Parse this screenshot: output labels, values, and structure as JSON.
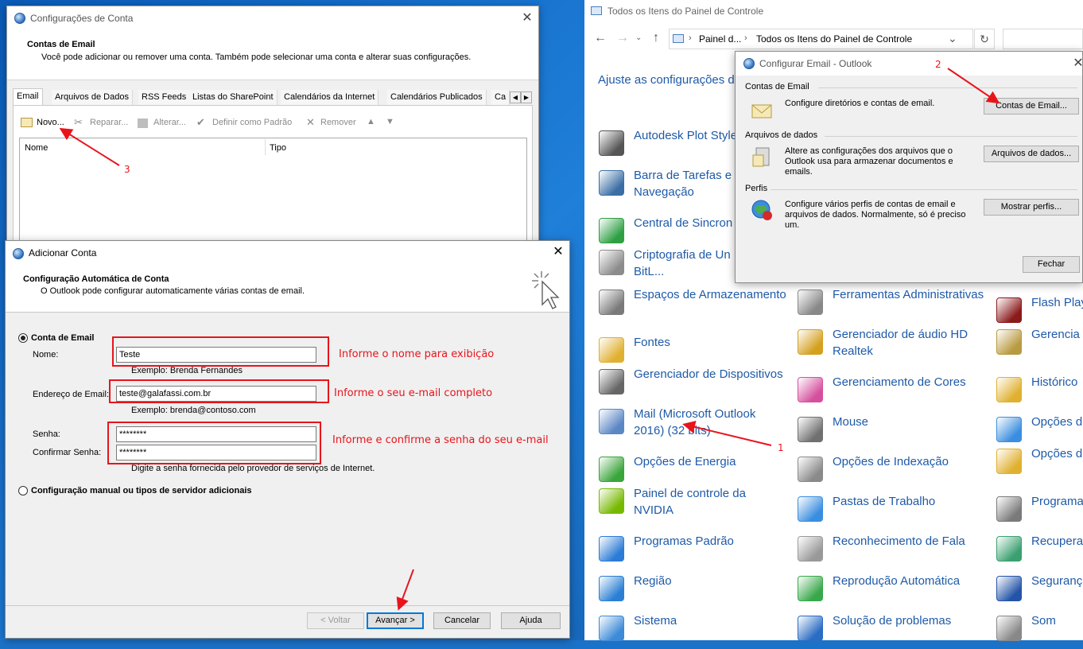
{
  "config_account": {
    "title": "Configurações de Conta",
    "heading": "Contas de Email",
    "description": "Você pode adicionar ou remover uma conta. Também pode selecionar uma conta e alterar suas configurações.",
    "tabs": [
      "Email",
      "Arquivos de Dados",
      "RSS Feeds",
      "Listas do SharePoint",
      "Calendários da Internet",
      "Calendários Publicados",
      "Ca"
    ],
    "toolbar": {
      "new": "Novo...",
      "repair": "Reparar...",
      "change": "Alterar...",
      "default": "Definir como Padrão",
      "remove": "Remover"
    },
    "columns": [
      "Nome",
      "Tipo"
    ]
  },
  "add_account": {
    "title": "Adicionar Conta",
    "heading": "Configuração Automática de Conta",
    "description": "O Outlook pode configurar automaticamente várias contas de email.",
    "email_account_label": "Conta de Email",
    "name_label": "Nome:",
    "name_value": "Teste",
    "name_example": "Exemplo: Brenda Fernandes",
    "email_label": "Endereço de Email:",
    "email_value": "teste@galafassi.com.br",
    "email_example": "Exemplo: brenda@contoso.com",
    "password_label": "Senha:",
    "password_value": "********",
    "confirm_label": "Confirmar Senha:",
    "confirm_value": "********",
    "password_hint": "Digite a senha fornecida pelo provedor de serviços de Internet.",
    "manual_label": "Configuração manual ou tipos de servidor adicionais",
    "buttons": {
      "back": "< Voltar",
      "next": "Avançar >",
      "cancel": "Cancelar",
      "help": "Ajuda"
    }
  },
  "annotations": {
    "name_hint": "Informe o nome para exibição",
    "email_hint": "Informe o seu e-mail completo",
    "password_hint": "Informe e confirme a senha do seu e-mail",
    "n1": "1",
    "n2": "2",
    "n3": "3"
  },
  "control_panel": {
    "title": "Todos os Itens do Painel de Controle",
    "breadcrumb_1": "Painel d...",
    "breadcrumb_2": "Todos os Itens do Painel de Controle",
    "adjust_heading": "Ajuste as configurações d",
    "col1": [
      {
        "label": "Autodesk Plot Style Manager",
        "icon": "printer-icon",
        "color": "#555555"
      },
      {
        "label": "Barra de Tarefas e Navegação",
        "icon": "taskbar-icon",
        "color": "#3a6ea5"
      },
      {
        "label": "Central de Sincron",
        "icon": "sync-icon",
        "color": "#2ea043"
      },
      {
        "label": "Criptografia de Un Disco BitL...",
        "icon": "key-icon",
        "color": "#8c8c8c"
      },
      {
        "label": "Espaços de Armazenamento",
        "icon": "storage-icon",
        "color": "#7a7a7a"
      },
      {
        "label": "Fontes",
        "icon": "font-icon",
        "color": "#e0b030"
      },
      {
        "label": "Gerenciador de Dispositivos",
        "icon": "device-manager-icon",
        "color": "#666666"
      },
      {
        "label": "Mail (Microsoft Outlook 2016) (32 bits)",
        "icon": "mail-icon",
        "color": "#5b87c5"
      },
      {
        "label": "Opções de Energia",
        "icon": "power-icon",
        "color": "#3aa53a"
      },
      {
        "label": "Painel de controle da NVIDIA",
        "icon": "nvidia-icon",
        "color": "#76b900"
      },
      {
        "label": "Programas Padrão",
        "icon": "default-programs-icon",
        "color": "#2c7bd6"
      },
      {
        "label": "Região",
        "icon": "region-icon",
        "color": "#2a7fd4"
      },
      {
        "label": "Sistema",
        "icon": "system-icon",
        "color": "#3c8ad8"
      }
    ],
    "col2": [
      {
        "label": "Ferramentas Administrativas",
        "icon": "admin-tools-icon",
        "color": "#888888"
      },
      {
        "label": "Gerenciador de áudio HD Realtek",
        "icon": "audio-icon",
        "color": "#d4a020"
      },
      {
        "label": "Gerenciamento de Cores",
        "icon": "color-management-icon",
        "color": "#d64f9e"
      },
      {
        "label": "Mouse",
        "icon": "mouse-icon",
        "color": "#707070"
      },
      {
        "label": "Opções de Indexação",
        "icon": "indexing-icon",
        "color": "#8a8a8a"
      },
      {
        "label": "Pastas de Trabalho",
        "icon": "work-folders-icon",
        "color": "#3a8ee0"
      },
      {
        "label": "Reconhecimento de Fala",
        "icon": "microphone-icon",
        "color": "#999999"
      },
      {
        "label": "Reprodução Automática",
        "icon": "autoplay-icon",
        "color": "#39a84b"
      },
      {
        "label": "Solução de problemas",
        "icon": "troubleshoot-icon",
        "color": "#2b6cc4"
      }
    ],
    "col3": [
      {
        "label": "Flash Play",
        "icon": "flash-icon",
        "color": "#8b1a1a"
      },
      {
        "label": "Gerencia Credencia",
        "icon": "credential-icon",
        "color": "#b89a40"
      },
      {
        "label": "Histórico",
        "icon": "history-icon",
        "color": "#e0b030"
      },
      {
        "label": "Opções d",
        "icon": "internet-options-icon",
        "color": "#3a8ee0"
      },
      {
        "label": "Opções d Arquivos",
        "icon": "folder-options-icon",
        "color": "#e0b030"
      },
      {
        "label": "Programa",
        "icon": "programs-icon",
        "color": "#7a7a7a"
      },
      {
        "label": "Recupera",
        "icon": "recovery-icon",
        "color": "#3aa070"
      },
      {
        "label": "Seguranç",
        "icon": "security-flag-icon",
        "color": "#2454a8"
      },
      {
        "label": "Som",
        "icon": "sound-icon",
        "color": "#888888"
      }
    ]
  },
  "configure_email": {
    "title": "Configurar Email - Outlook",
    "email_section": "Contas de Email",
    "email_desc": "Configure diretórios e contas de email.",
    "email_button": "Contas de Email...",
    "data_section": "Arquivos de dados",
    "data_desc": "Altere as configurações dos arquivos que o Outlook usa para armazenar documentos e emails.",
    "data_button": "Arquivos de dados...",
    "profiles_section": "Perfis",
    "profiles_desc": "Configure vários perfis de contas de email e arquivos de dados. Normalmente, só é preciso um.",
    "profiles_button": "Mostrar perfis...",
    "close_button": "Fechar"
  }
}
